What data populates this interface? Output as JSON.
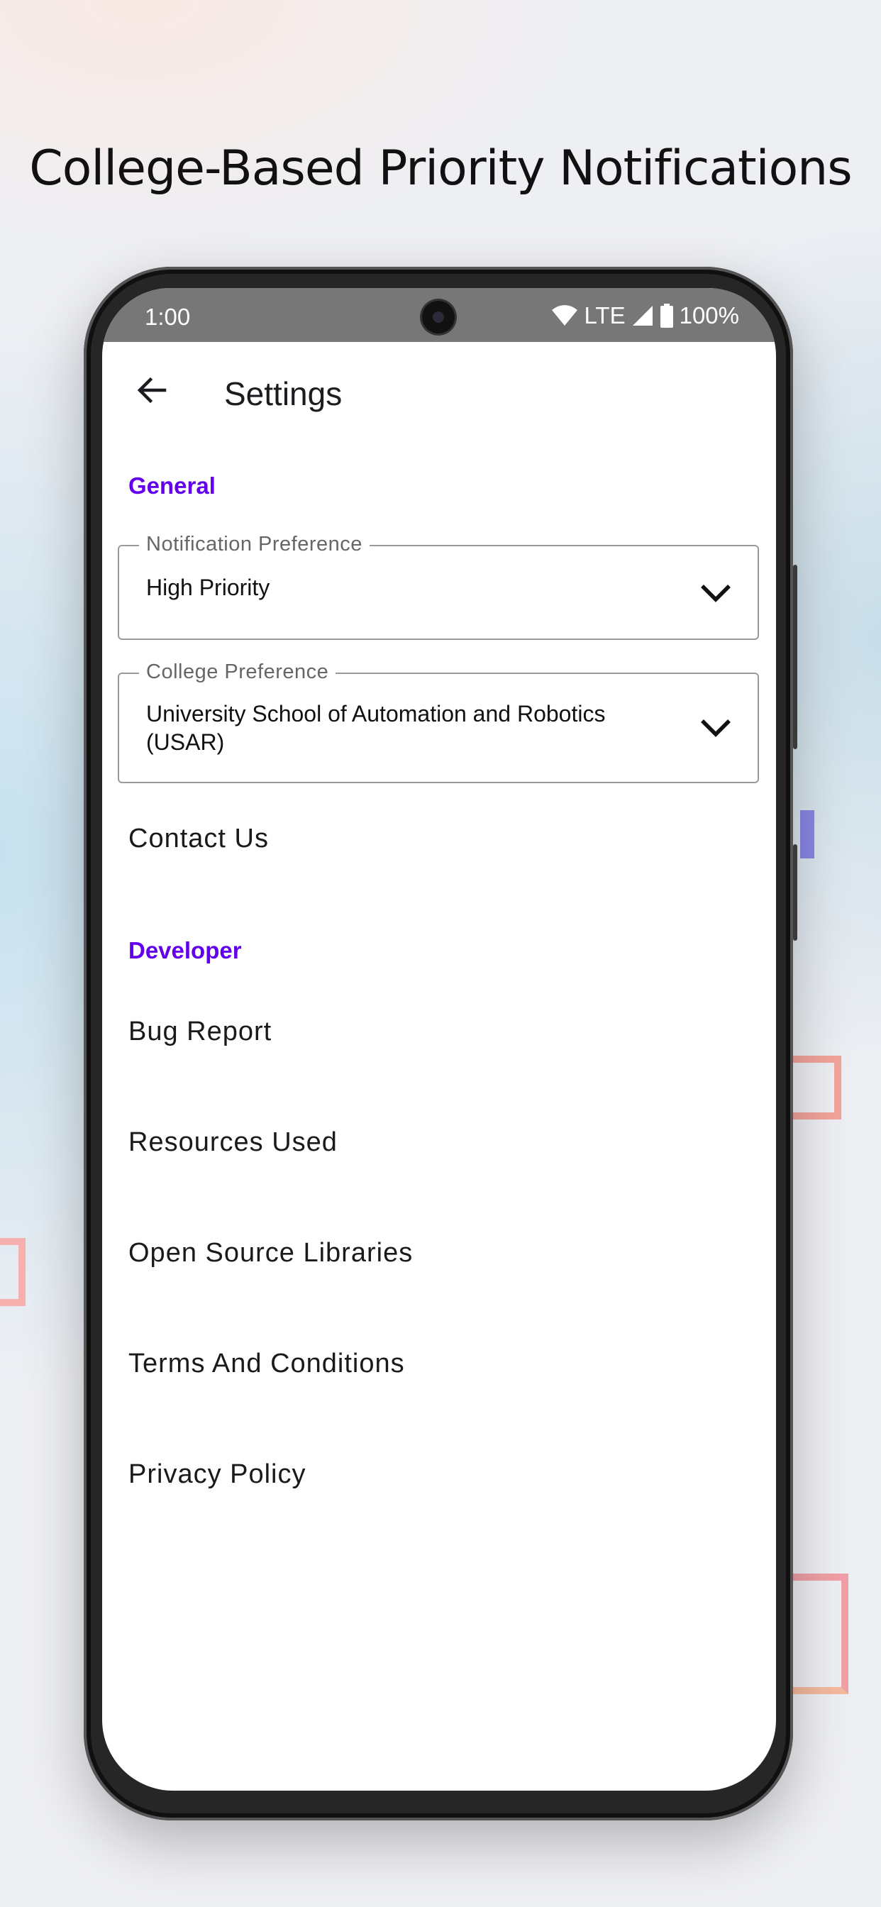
{
  "promo": {
    "title": "College-Based Priority Notifications"
  },
  "status_bar": {
    "time": "1:00",
    "network": "LTE",
    "battery": "100%"
  },
  "app_bar": {
    "title": "Settings",
    "back_icon": "arrow-back-icon"
  },
  "sections": {
    "general": {
      "header": "General",
      "notification_preference": {
        "label": "Notification Preference",
        "value": "High Priority"
      },
      "college_preference": {
        "label": "College Preference",
        "value": "University School of Automation and Robotics (USAR)"
      },
      "contact_us": "Contact Us"
    },
    "developer": {
      "header": "Developer",
      "items": [
        "Bug Report",
        "Resources Used",
        "Open Source Libraries",
        "Terms And Conditions",
        "Privacy Policy"
      ]
    }
  },
  "colors": {
    "accent": "#6200ee",
    "status_bar": "#777777",
    "text_primary": "#1a1a1a"
  },
  "icons": [
    "wifi-icon",
    "cell-signal-icon",
    "battery-icon",
    "chevron-down-icon",
    "arrow-back-icon"
  ]
}
